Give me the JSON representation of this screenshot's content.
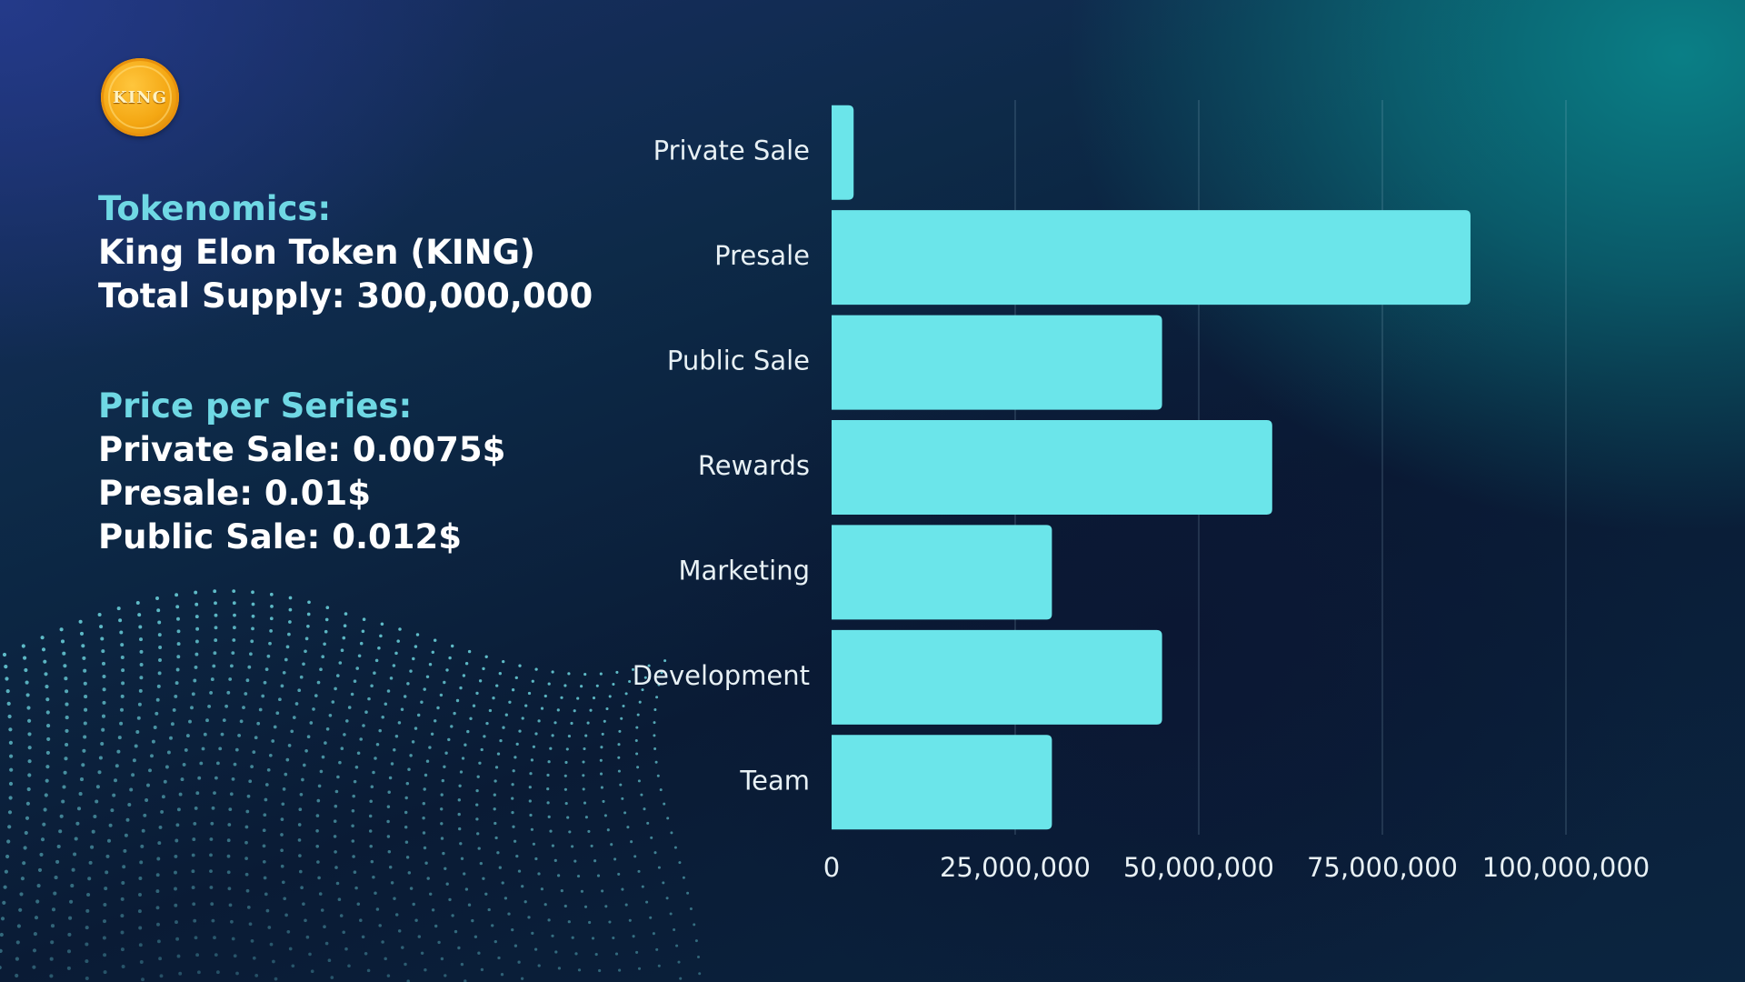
{
  "logo": {
    "text": "KING",
    "colors": {
      "coin": "#f4a713",
      "rim": "#e8920c"
    }
  },
  "info": {
    "tokenomics_heading": "Tokenomics:",
    "token_name": "King Elon Token (KING)",
    "total_supply": "Total Supply: 300,000,000",
    "price_heading": "Price per Series:",
    "prices": [
      "Private Sale: 0.0075$",
      "Presale: 0.01$",
      "Public Sale: 0.012$"
    ]
  },
  "colors": {
    "heading": "#6fd8e4",
    "bar": "#6be5ea",
    "text": "#ffffff"
  },
  "chart_data": {
    "type": "bar",
    "orientation": "horizontal",
    "categories": [
      "Private Sale",
      "Presale",
      "Public Sale",
      "Rewards",
      "Marketing",
      "Development",
      "Team"
    ],
    "values": [
      3000000,
      87000000,
      45000000,
      60000000,
      30000000,
      45000000,
      30000000
    ],
    "xlim": [
      0,
      100000000
    ],
    "xticks": [
      0,
      25000000,
      50000000,
      75000000,
      100000000
    ],
    "xtick_labels": [
      "0",
      "25,000,000",
      "50,000,000",
      "75,000,000",
      "100,000,000"
    ],
    "grid": "vertical",
    "legend": "none"
  }
}
